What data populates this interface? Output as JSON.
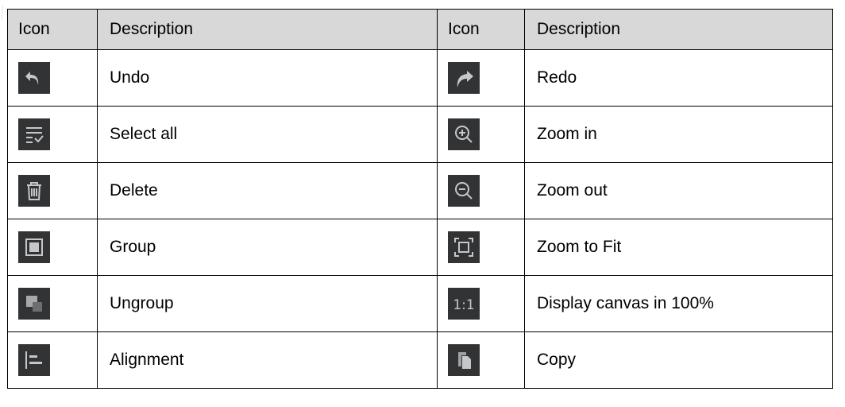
{
  "table": {
    "headers": [
      "Icon",
      "Description",
      "Icon",
      "Description"
    ],
    "rows": [
      {
        "left": {
          "icon": "undo-icon",
          "label": "Undo"
        },
        "right": {
          "icon": "redo-icon",
          "label": "Redo"
        }
      },
      {
        "left": {
          "icon": "select-all-icon",
          "label": "Select all"
        },
        "right": {
          "icon": "zoom-in-icon",
          "label": "Zoom in"
        }
      },
      {
        "left": {
          "icon": "delete-icon",
          "label": "Delete"
        },
        "right": {
          "icon": "zoom-out-icon",
          "label": "Zoom out"
        }
      },
      {
        "left": {
          "icon": "group-icon",
          "label": "Group"
        },
        "right": {
          "icon": "zoom-to-fit-icon",
          "label": "Zoom to Fit"
        }
      },
      {
        "left": {
          "icon": "ungroup-icon",
          "label": "Ungroup"
        },
        "right": {
          "icon": "actual-size-icon",
          "label": "Display canvas in 100%"
        }
      },
      {
        "left": {
          "icon": "alignment-icon",
          "label": "Alignment"
        },
        "right": {
          "icon": "copy-icon",
          "label": "Copy"
        }
      }
    ]
  },
  "colors": {
    "icon_background": "#323335",
    "icon_foreground": "#c7c7c7",
    "header_background": "#d8d8d8",
    "border": "#000000"
  }
}
